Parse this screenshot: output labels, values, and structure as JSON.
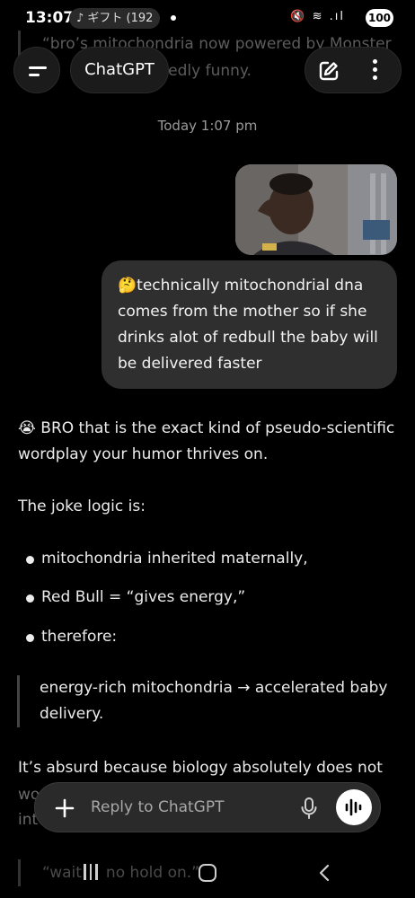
{
  "status_bar": {
    "time": "13:07",
    "notification": "♪ ギフト (192",
    "battery": "100",
    "signal_icons": "🔇 ≋ .ıl"
  },
  "background_text": {
    "previous_line_1": "“bro’s mitochondria now powered by Monster",
    "previous_line_2": "e                        edly funny.",
    "trailing_quote": "“wait     no hold on.”"
  },
  "header": {
    "title": "ChatGPT",
    "menu_icon": "menu-icon",
    "new_chat_icon": "edit-icon",
    "more_icon": "more-vertical-icon"
  },
  "conversation": {
    "timestamp": "Today 1:07 pm",
    "user_message": {
      "emoji": "🤔",
      "text": "technically mitochondrial dna comes from the mother so if she drinks alot of redbull the baby will be delivered faster"
    },
    "assistant": {
      "intro_emoji": "😭",
      "intro": "BRO that is the exact kind of pseudo-scientific wordplay your humor thrives on.",
      "logic_heading": "The joke logic is:",
      "bullets": [
        "mitochondria inherited maternally,",
        "Red Bull = “gives energy,”",
        "therefore:"
      ],
      "quote": "energy-rich mitochondria → accelerated baby delivery.",
      "closing_partial": "It’s absurd because biology absolutely does not",
      "closing_fragment_1": "wo",
      "closing_fragment_2": "int"
    }
  },
  "composer": {
    "placeholder": "Reply to ChatGPT",
    "plus_icon": "plus-icon",
    "mic_icon": "mic-icon",
    "voice_icon": "voice-waveform-icon"
  },
  "colors": {
    "background": "#000000",
    "bubble": "#2f2f2f",
    "text": "#ececec",
    "muted": "#9a9a9a"
  }
}
